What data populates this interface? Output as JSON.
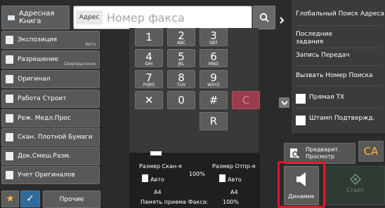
{
  "top": {
    "address_book_label": "Адресная Книга",
    "address_tag": "Адрес",
    "fax_placeholder": "Номер факса"
  },
  "left_menu": [
    {
      "label": "Экспозиция",
      "sub": "Авто"
    },
    {
      "label": "Разрешение",
      "sub": "Сверхвысокое"
    },
    {
      "label": "Оригинал",
      "sub": ""
    },
    {
      "label": "Работа Строит",
      "sub": ""
    },
    {
      "label": "Реж. Медл.Прос",
      "sub": ""
    },
    {
      "label": "Скан. Плотной Бумаги",
      "sub": ""
    },
    {
      "label": "Док.Смеш.Разм.",
      "sub": ""
    },
    {
      "label": "Учет Оригиналов",
      "sub": ""
    }
  ],
  "keypad": {
    "keys": [
      {
        "main": "1",
        "sub": ""
      },
      {
        "main": "2",
        "sub": "ABC"
      },
      {
        "main": "3",
        "sub": "DEF"
      },
      {
        "main": "4",
        "sub": "GHI"
      },
      {
        "main": "5",
        "sub": "JKL"
      },
      {
        "main": "6",
        "sub": "MNO"
      },
      {
        "main": "7",
        "sub": "PQRS"
      },
      {
        "main": "8",
        "sub": "TUV"
      },
      {
        "main": "9",
        "sub": "WXYZ"
      },
      {
        "main": "✕",
        "sub": ""
      },
      {
        "main": "0",
        "sub": ""
      },
      {
        "main": "#",
        "sub": ""
      },
      {
        "main": "C",
        "sub": ""
      },
      {
        "main": "R",
        "sub": ""
      }
    ]
  },
  "right_panel": {
    "items": [
      "Глобальный Поиск Адреса",
      "Последние задания",
      "Запись Передач",
      "Вызвать Номер Поиска"
    ],
    "checkbox_1": "Прямая TX",
    "checkbox_2": "Штамп Подтвержд."
  },
  "info": {
    "scan_size_label": "Размер Скан-я",
    "send_size_label": "Размер Отпр-я",
    "zoom": "100%",
    "scan_auto": "Авто",
    "send_auto": "Авто",
    "scan_paper": "A4",
    "send_paper": "A4",
    "fax_memory_label": "Память приема Факса:",
    "fax_memory_value": "100%"
  },
  "buttons": {
    "preview": "Предварит. Просмотр",
    "ca": "CA",
    "dynamic": "Динамик",
    "start": "Старт",
    "other": "Прочие"
  }
}
